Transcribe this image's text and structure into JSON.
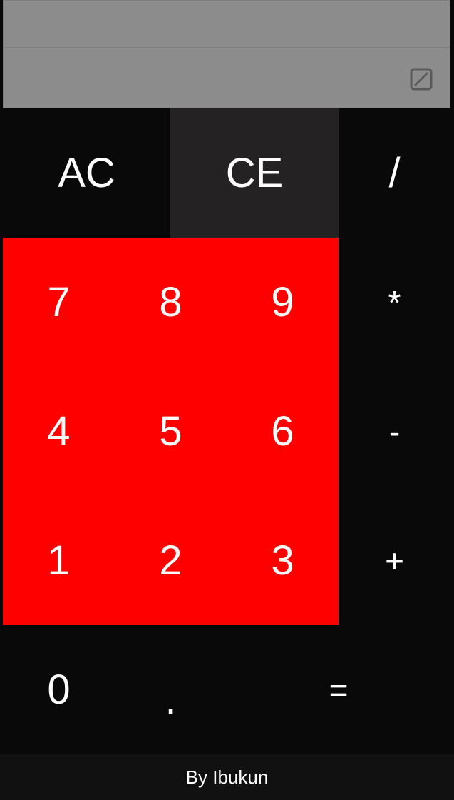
{
  "display": {
    "expression": "",
    "result": "",
    "toggle_icon": "square-slash-icon"
  },
  "keys": {
    "ac": "AC",
    "ce": "CE",
    "divide": "/",
    "multiply": "*",
    "subtract": "-",
    "add": "+",
    "equals": "=",
    "decimal": ".",
    "d0": "0",
    "d1": "1",
    "d2": "2",
    "d3": "3",
    "d4": "4",
    "d5": "5",
    "d6": "6",
    "d7": "7",
    "d8": "8",
    "d9": "9"
  },
  "footer": {
    "credit": "By Ibukun"
  },
  "colors": {
    "display_bg": "#8c8c8c",
    "keypad_bg": "#0a090a",
    "digit_block": "#ff0000",
    "ce_bg": "#242223",
    "footer_bg": "#111111",
    "text": "#ffffff"
  }
}
